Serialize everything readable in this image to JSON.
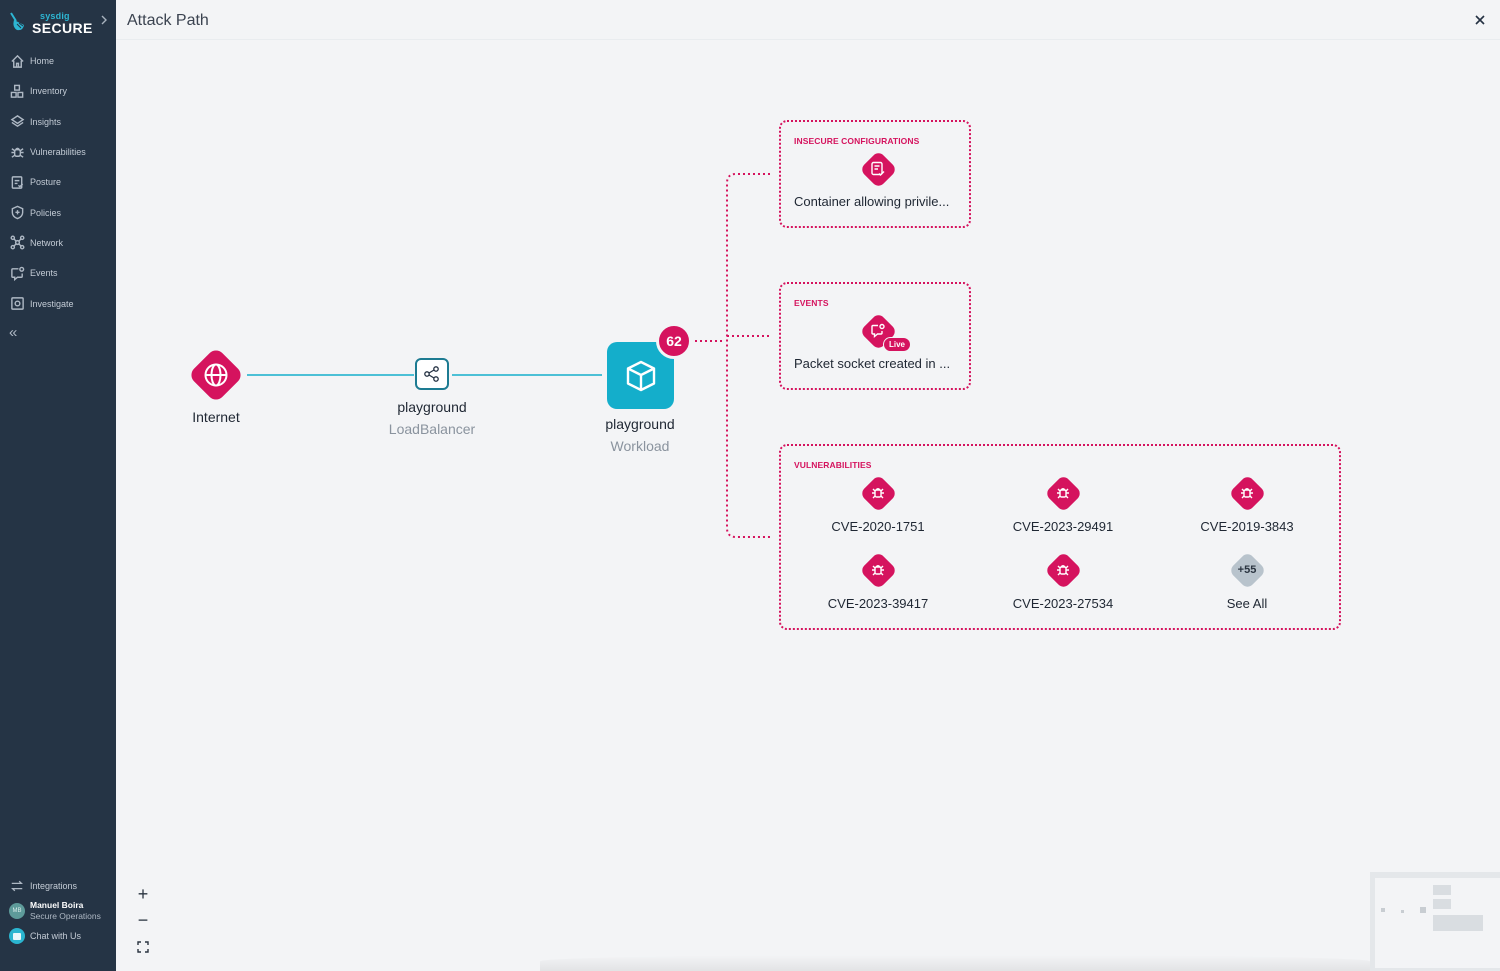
{
  "brand": {
    "sub": "sysdig",
    "main": "SECURE"
  },
  "sidebar": {
    "items": [
      {
        "label": "Home",
        "icon": "home-icon"
      },
      {
        "label": "Inventory",
        "icon": "inventory-icon"
      },
      {
        "label": "Insights",
        "icon": "layers-icon"
      },
      {
        "label": "Vulnerabilities",
        "icon": "bug-icon"
      },
      {
        "label": "Posture",
        "icon": "posture-icon"
      },
      {
        "label": "Policies",
        "icon": "shield-icon"
      },
      {
        "label": "Network",
        "icon": "network-icon"
      },
      {
        "label": "Events",
        "icon": "events-icon"
      },
      {
        "label": "Investigate",
        "icon": "investigate-icon"
      }
    ],
    "collapse_glyph": "«",
    "integrations_label": "Integrations",
    "user": {
      "initials": "MB",
      "name": "Manuel Boira",
      "role": "Secure Operations"
    },
    "chat_label": "Chat with Us"
  },
  "header": {
    "title": "Attack Path"
  },
  "graph": {
    "internet": {
      "label": "Internet"
    },
    "load_balancer": {
      "name": "playground",
      "type": "LoadBalancer"
    },
    "workload": {
      "name": "playground",
      "type": "Workload",
      "findings_count": "62"
    },
    "groups": {
      "insecure_configurations": {
        "title": "INSECURE CONFIGURATIONS",
        "item": "Container allowing privile..."
      },
      "events": {
        "title": "EVENTS",
        "item": "Packet socket created in ...",
        "live_label": "Live"
      },
      "vulnerabilities": {
        "title": "VULNERABILITIES",
        "items": [
          "CVE-2020-1751",
          "CVE-2023-29491",
          "CVE-2019-3843",
          "CVE-2023-39417",
          "CVE-2023-27534"
        ],
        "more_count": "+55",
        "see_all_label": "See All"
      }
    },
    "colors": {
      "finding": "#d5135e",
      "edge": "#14aecb",
      "workload": "#14aecb",
      "more": "#b8c3cc"
    }
  },
  "controls": {
    "zoom_in": "+",
    "zoom_out": "−"
  }
}
